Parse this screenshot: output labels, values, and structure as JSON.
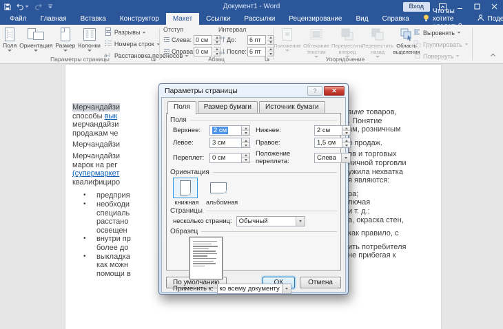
{
  "titlebar": {
    "title": "Документ1 - Word",
    "signin": "Вход"
  },
  "tabs": [
    {
      "label": "Файл"
    },
    {
      "label": "Главная"
    },
    {
      "label": "Вставка"
    },
    {
      "label": "Конструктор"
    },
    {
      "label": "Макет",
      "active": true
    },
    {
      "label": "Ссылки"
    },
    {
      "label": "Рассылки"
    },
    {
      "label": "Рецензирование"
    },
    {
      "label": "Вид"
    },
    {
      "label": "Справка"
    }
  ],
  "assistant_label": "Что вы хотите сделать?",
  "share_label": "Поделиться",
  "ribbon": {
    "page_setup": {
      "label": "Параметры страницы",
      "big": [
        {
          "label": "Поля"
        },
        {
          "label": "Ориентация"
        },
        {
          "label": "Размер"
        },
        {
          "label": "Колонки"
        }
      ],
      "small": [
        {
          "label": "Разрывы"
        },
        {
          "label": "Номера строк"
        },
        {
          "label": "Расстановка переносов"
        }
      ]
    },
    "paragraph": {
      "label": "Абзац",
      "indent_header": "Отступ",
      "spacing_header": "Интервал",
      "fields": {
        "left": {
          "label": "Слева:",
          "value": "0 см"
        },
        "right": {
          "label": "Справа:",
          "value": "0 см"
        },
        "before": {
          "label": "До:",
          "value": "6 пт"
        },
        "after": {
          "label": "После:",
          "value": "6 пт"
        }
      }
    },
    "arrange": {
      "label": "Упорядочение",
      "big": [
        {
          "label": "Положение",
          "disabled": true
        },
        {
          "label": "Обтекание текстом",
          "disabled": true
        },
        {
          "label": "Переместить вперед",
          "disabled": true
        },
        {
          "label": "Переместить назад",
          "disabled": true
        },
        {
          "label": "Область выделения",
          "disabled": false
        }
      ],
      "side": [
        {
          "label": "Выровнять",
          "disabled": false
        },
        {
          "label": "Группировать",
          "disabled": true
        },
        {
          "label": "Повернуть",
          "disabled": true
        }
      ]
    }
  },
  "document": {
    "left_lines": [
      {
        "text": "Мерчандайзи",
        "selected": true
      },
      {
        "prefix": "способы ",
        "link": "вык"
      },
      {
        "text": "мерчандайзи"
      },
      {
        "text": "продажам че"
      },
      {
        "text": "Мерчандайзи"
      },
      {
        "text": "Мерчандайзи"
      },
      {
        "text": "марок на рег"
      },
      {
        "link": "(супермаркет"
      },
      {
        "text": "квалифициро"
      },
      {
        "text": "предприя",
        "bullet": true
      },
      {
        "text": "необходи",
        "bullet": true
      },
      {
        "text": "специаль"
      },
      {
        "text": "расстано"
      },
      {
        "text": "освещен"
      },
      {
        "text": "внутри пр",
        "bullet": true
      },
      {
        "text": "более до"
      },
      {
        "text": "выкладка",
        "bullet": true
      },
      {
        "text": "как можн"
      },
      {
        "text": "помощи в"
      }
    ],
    "right_lines": [
      {
        "italic": "зине",
        "text": " товаров,"
      },
      {
        "text": ". Понятие"
      },
      {
        "text": "ам, розничным"
      },
      {
        "text": "и продаж."
      },
      {
        "text": "ов и торговых"
      },
      {
        "text": "ничной торговли"
      },
      {
        "text": "ужила нехватка"
      },
      {
        "text": "я являются:"
      },
      {
        "text": "ра;"
      },
      {
        "text": "лючая"
      },
      {
        "text": "и т. д.;"
      },
      {
        "text": "а, окраска стен,"
      },
      {
        "text": "как правило, с"
      },
      {
        "text": "ить потребителя"
      },
      {
        "text": "не прибегая к"
      }
    ]
  },
  "dialog": {
    "title": "Параметры страницы",
    "tabs": [
      {
        "label": "Поля",
        "active": true
      },
      {
        "label": "Размер бумаги"
      },
      {
        "label": "Источник бумаги"
      }
    ],
    "margins": {
      "header": "Поля",
      "top": {
        "label": "Верхнее:",
        "value": "2 см"
      },
      "bottom": {
        "label": "Нижнее:",
        "value": "2 см"
      },
      "left": {
        "label": "Левое:",
        "value": "3 см"
      },
      "right": {
        "label": "Правое:",
        "value": "1,5 см"
      },
      "gutter": {
        "label": "Переплет:",
        "value": "0 см"
      },
      "gutter_position": {
        "label": "Положение переплета:",
        "value": "Слева"
      }
    },
    "orientation": {
      "header": "Ориентация",
      "portrait": "книжная",
      "landscape": "альбомная",
      "selected": "книжная"
    },
    "pages": {
      "header": "Страницы",
      "multiple_label": "несколько страниц:",
      "multiple_value": "Обычный"
    },
    "preview": {
      "header": "Образец",
      "apply_label": "Применить к:",
      "apply_value": "ко всему документу"
    },
    "buttons": {
      "default": "По умолчанию",
      "ok": "ОК",
      "cancel": "Отмена"
    }
  },
  "colors": {
    "accent": "#2b579a",
    "selection": "#4d94e8",
    "link": "#0a5fb4",
    "dialog_close": "#c23535",
    "text_selection_inactive": "#cdd2d8"
  },
  "icons": {
    "save": "floppy-disk",
    "undo": "curved-arrow-left",
    "redo": "curved-arrow-right",
    "qat-menu": "chevron-down",
    "assistant": "lightbulb",
    "share": "person",
    "minimize": "dash",
    "maximize": "square",
    "close": "x",
    "dialog-help": "question-mark",
    "dialog-close": "x",
    "dialog-launcher": "corner-arrow",
    "collapse-ribbon": "chevron-up"
  }
}
